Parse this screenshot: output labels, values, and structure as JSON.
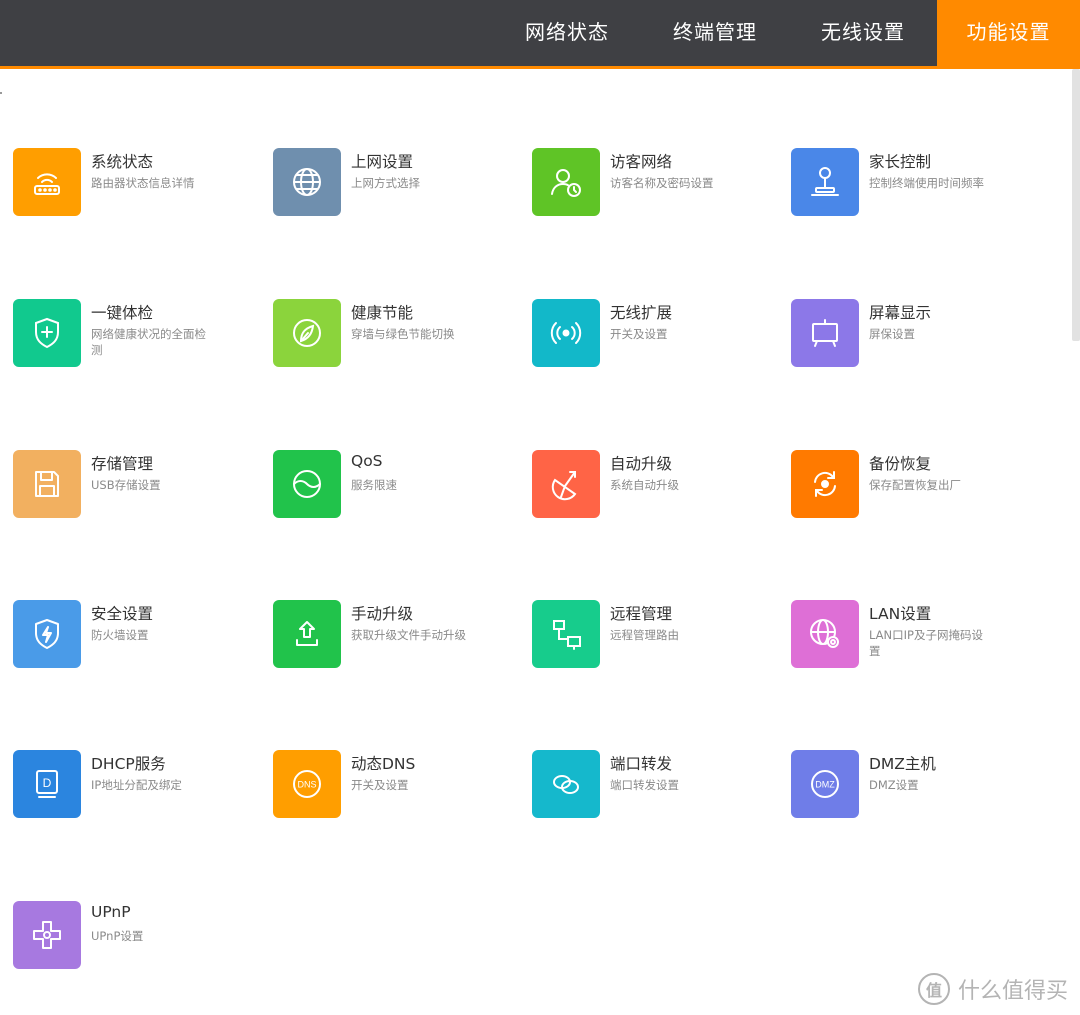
{
  "nav": {
    "items": [
      {
        "label": "网络状态"
      },
      {
        "label": "终端管理"
      },
      {
        "label": "无线设置"
      },
      {
        "label": "功能设置",
        "active": true
      }
    ],
    "accent": "#ff8a00",
    "bar_color": "#3f4044"
  },
  "tiles": [
    {
      "title": "系统状态",
      "desc": "路由器状态信息详情",
      "color": "#ff9e00",
      "icon": "router-icon"
    },
    {
      "title": "上网设置",
      "desc": "上网方式选择",
      "color": "#6f8fae",
      "icon": "globe-icon"
    },
    {
      "title": "访客网络",
      "desc": "访客名称及密码设置",
      "color": "#5fc426",
      "icon": "guest-user-icon"
    },
    {
      "title": "家长控制",
      "desc": "控制终端使用时间频率",
      "color": "#4a87e8",
      "icon": "joystick-icon"
    },
    {
      "title": "一键体检",
      "desc": "网络健康状况的全面检测",
      "color": "#11c98e",
      "icon": "shield-plus-icon"
    },
    {
      "title": "健康节能",
      "desc": "穿墙与绿色节能切换",
      "color": "#8bd43c",
      "icon": "leaf-icon"
    },
    {
      "title": "无线扩展",
      "desc": "开关及设置",
      "color": "#12b8c9",
      "icon": "wireless-signal-icon"
    },
    {
      "title": "屏幕显示",
      "desc": "屏保设置",
      "color": "#8c78e8",
      "icon": "screen-icon"
    },
    {
      "title": "存储管理",
      "desc": "USB存储设置",
      "color": "#f2b060",
      "icon": "storage-icon"
    },
    {
      "title": "QoS",
      "desc": "服务限速",
      "color": "#21c34b",
      "icon": "qos-icon"
    },
    {
      "title": "自动升级",
      "desc": "系统自动升级",
      "color": "#ff6446",
      "icon": "auto-upgrade-icon"
    },
    {
      "title": "备份恢复",
      "desc": "保存配置恢复出厂",
      "color": "#ff7a00",
      "icon": "backup-icon"
    },
    {
      "title": "安全设置",
      "desc": "防火墙设置",
      "color": "#4a9be8",
      "icon": "security-shield-icon"
    },
    {
      "title": "手动升级",
      "desc": "获取升级文件手动升级",
      "color": "#21c34b",
      "icon": "upload-icon"
    },
    {
      "title": "远程管理",
      "desc": "远程管理路由",
      "color": "#17cc8c",
      "icon": "remote-network-icon"
    },
    {
      "title": "LAN设置",
      "desc": "LAN口IP及子网掩码设置",
      "color": "#de6fd6",
      "icon": "lan-globe-icon"
    },
    {
      "title": "DHCP服务",
      "desc": "IP地址分配及绑定",
      "color": "#2b85df",
      "icon": "dhcp-icon"
    },
    {
      "title": "动态DNS",
      "desc": "开关及设置",
      "color": "#ff9e00",
      "icon": "dns-icon"
    },
    {
      "title": "端口转发",
      "desc": "端口转发设置",
      "color": "#15b8cc",
      "icon": "link-icon"
    },
    {
      "title": "DMZ主机",
      "desc": "DMZ设置",
      "color": "#6f7de8",
      "icon": "dmz-icon"
    },
    {
      "title": "UPnP",
      "desc": "UPnP设置",
      "color": "#a779e0",
      "icon": "upnp-icon"
    }
  ],
  "icon_labels": {
    "dns": "DNS",
    "dmz": "DMZ",
    "dhcp": "D"
  },
  "watermark": {
    "logo": "值",
    "text": "什么值得买"
  }
}
